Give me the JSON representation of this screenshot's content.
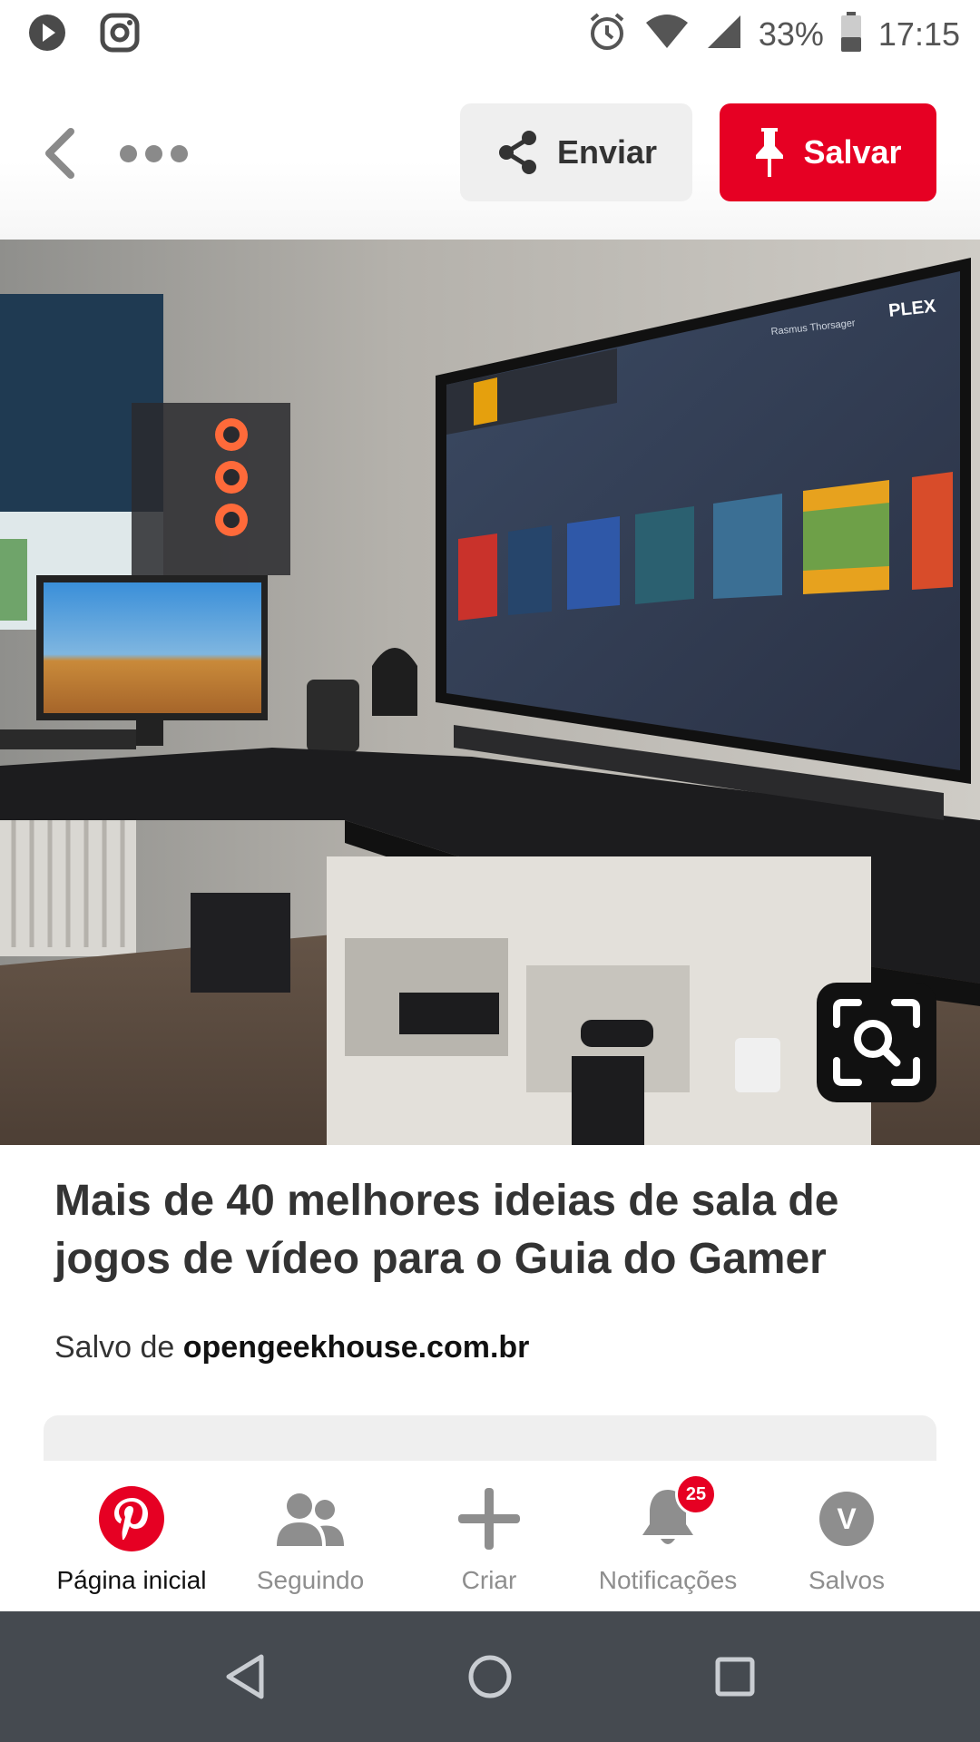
{
  "status_bar": {
    "battery": "33%",
    "time": "17:15",
    "left_icons": [
      "play-icon",
      "instagram-icon"
    ],
    "right_icons": [
      "alarm-icon",
      "wifi-icon",
      "signal-icon",
      "battery-icon"
    ]
  },
  "toolbar": {
    "back_icon": "chevron-left-icon",
    "more_icon": "more-dots-icon",
    "send_label": "Enviar",
    "save_label": "Salvar"
  },
  "pin": {
    "image_description_icon": "visual-search-icon",
    "tv_logo": "PLEX",
    "tv_user": "Rasmus Thorsager",
    "title": "Mais de 40 melhores ideias de sala de jogos de vídeo para o Guia do Gamer",
    "saved_from_prefix": "Salvo de ",
    "saved_from_domain": "opengeekhouse.com.br"
  },
  "bottom_nav": {
    "items": [
      {
        "label": "Página inicial",
        "icon": "pinterest-logo-icon",
        "active": true
      },
      {
        "label": "Seguindo",
        "icon": "people-icon",
        "active": false
      },
      {
        "label": "Criar",
        "icon": "plus-icon",
        "active": false
      },
      {
        "label": "Notificações",
        "icon": "bell-icon",
        "active": false,
        "badge": "25"
      },
      {
        "label": "Salvos",
        "icon": "avatar",
        "active": false,
        "avatar_letter": "V"
      }
    ]
  },
  "colors": {
    "brand_red": "#e60023",
    "system_nav": "#454a50"
  }
}
